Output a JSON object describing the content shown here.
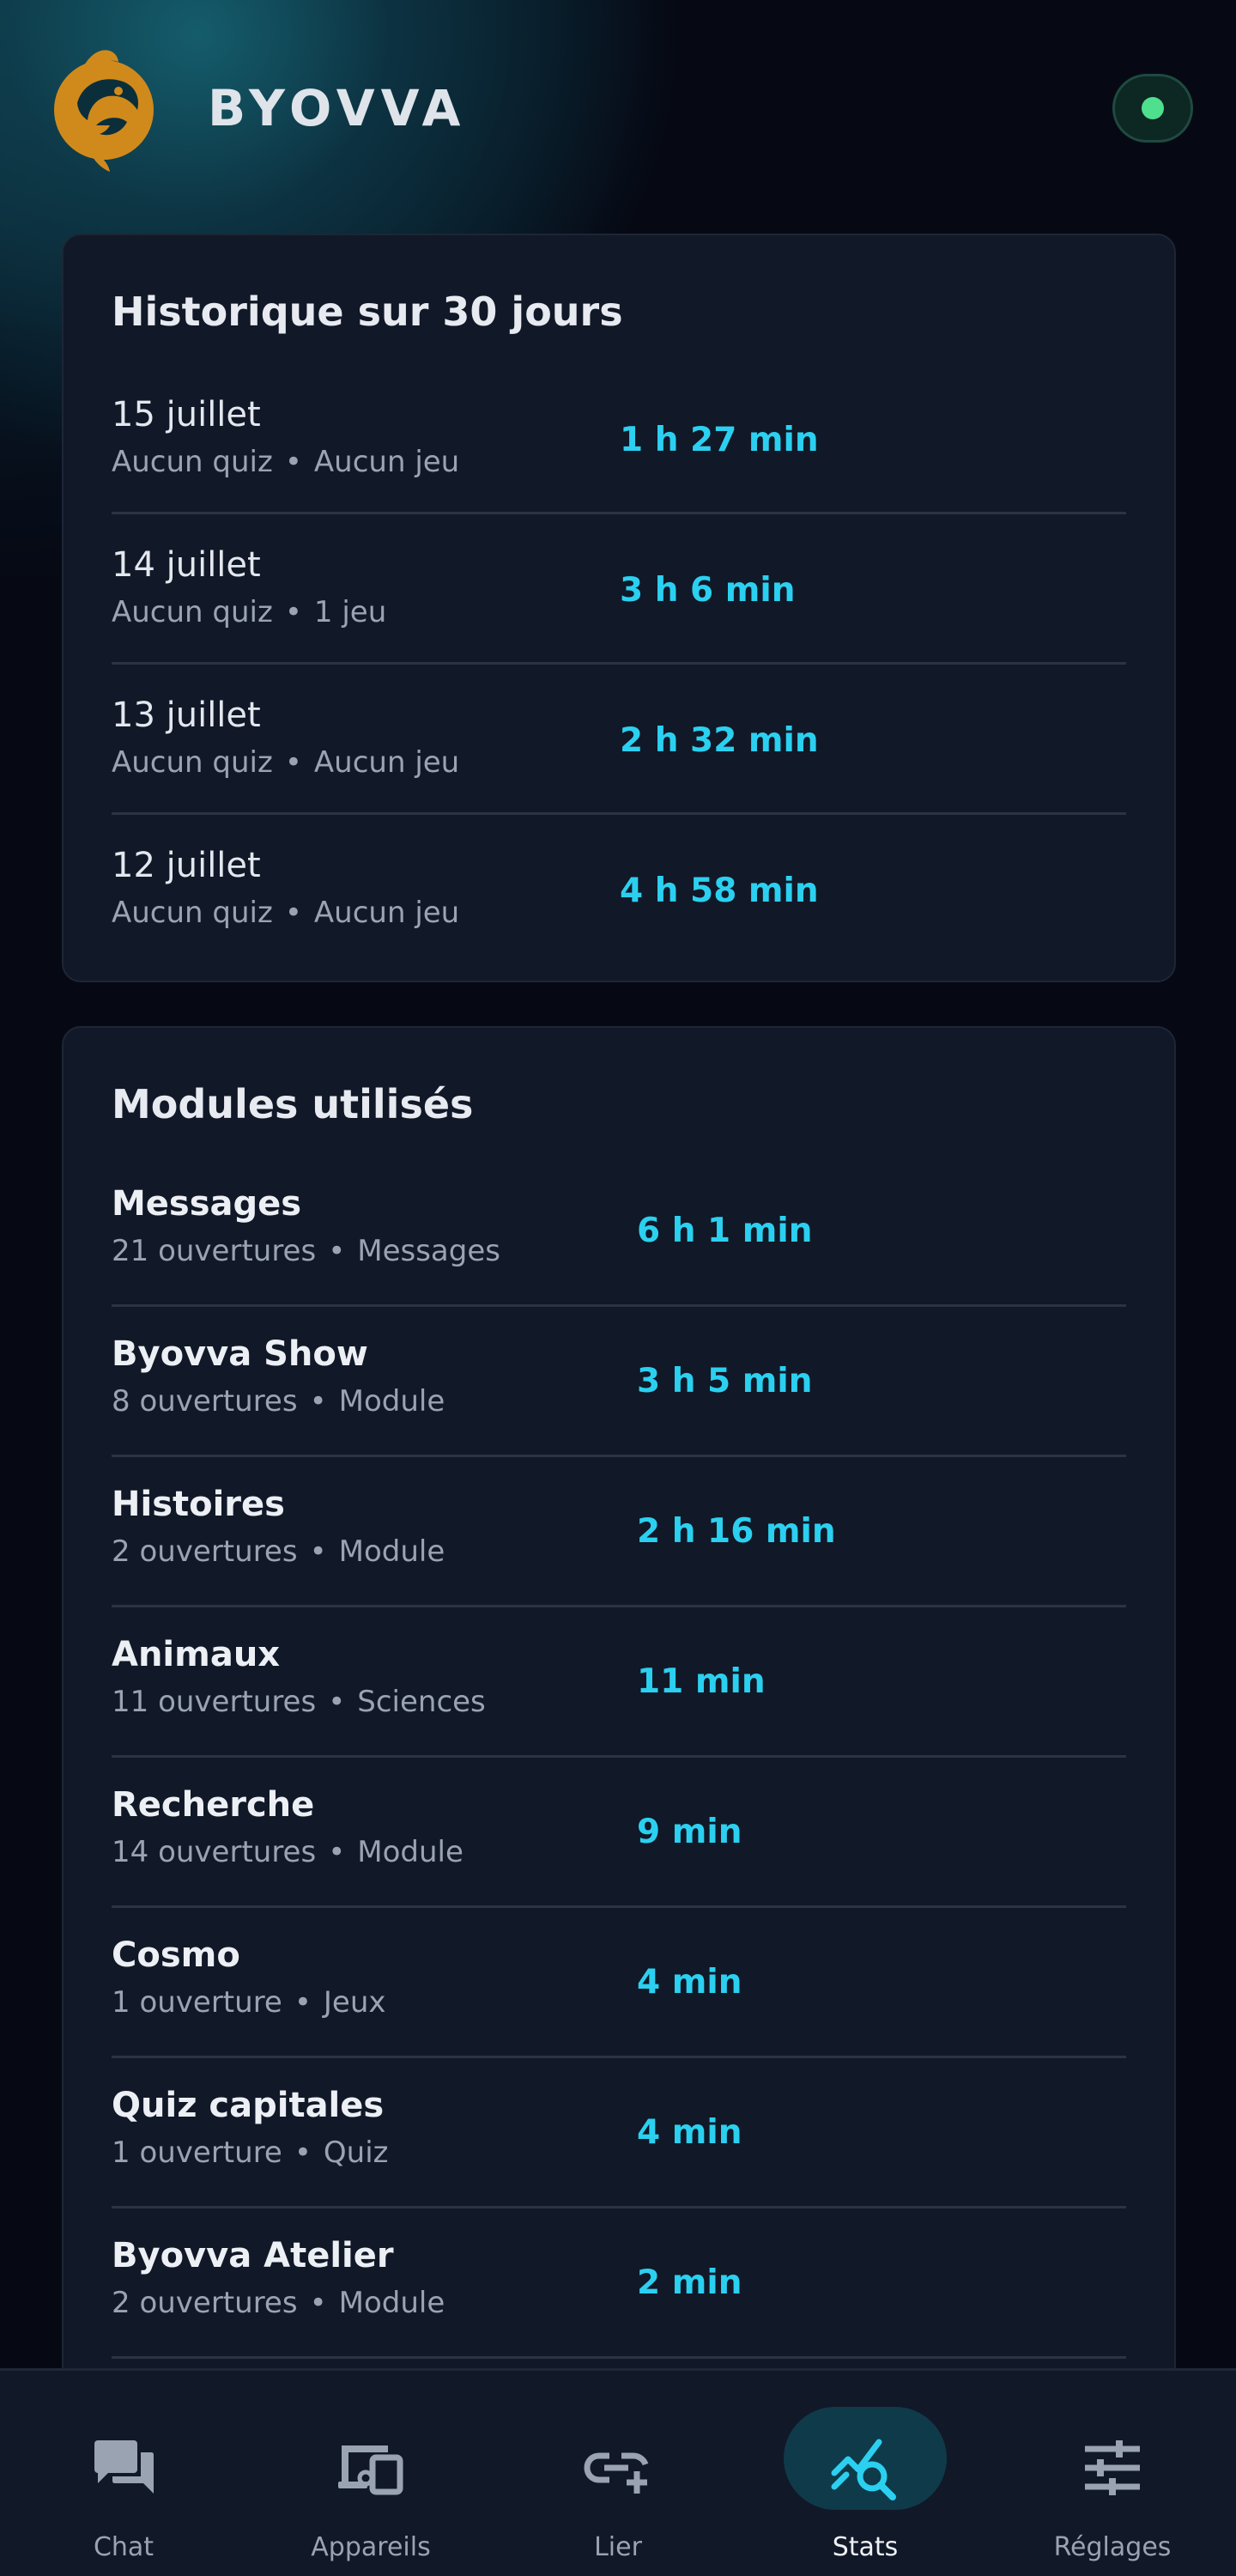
{
  "app": {
    "brand": "BYOVVA"
  },
  "history": {
    "title": "Historique sur 30 jours",
    "rows": [
      {
        "date": "15 juillet",
        "quiz": "Aucun quiz",
        "game": "Aucun jeu",
        "time": "1 h 27 min"
      },
      {
        "date": "14 juillet",
        "quiz": "Aucun quiz",
        "game": "1 jeu",
        "time": "3 h 6 min"
      },
      {
        "date": "13 juillet",
        "quiz": "Aucun quiz",
        "game": "Aucun jeu",
        "time": "2 h 32 min"
      },
      {
        "date": "12 juillet",
        "quiz": "Aucun quiz",
        "game": "Aucun jeu",
        "time": "4 h 58 min"
      }
    ]
  },
  "modules": {
    "title": "Modules utilisés",
    "rows": [
      {
        "name": "Messages",
        "opens": "21 ouvertures",
        "category": "Messages",
        "time": "6 h 1 min"
      },
      {
        "name": "Byovva Show",
        "opens": "8 ouvertures",
        "category": "Module",
        "time": "3 h 5 min"
      },
      {
        "name": "Histoires",
        "opens": "2 ouvertures",
        "category": "Module",
        "time": "2 h 16 min"
      },
      {
        "name": "Animaux",
        "opens": "11 ouvertures",
        "category": "Sciences",
        "time": "11 min"
      },
      {
        "name": "Recherche",
        "opens": "14 ouvertures",
        "category": "Module",
        "time": "9 min"
      },
      {
        "name": "Cosmo",
        "opens": "1 ouverture",
        "category": "Jeux",
        "time": "4 min"
      },
      {
        "name": "Quiz capitales",
        "opens": "1 ouverture",
        "category": "Quiz",
        "time": "4 min"
      },
      {
        "name": "Byovva Atelier",
        "opens": "2 ouvertures",
        "category": "Module",
        "time": "2 min"
      }
    ]
  },
  "separator": "•",
  "nav": {
    "items": [
      {
        "label": "Chat",
        "icon": "chat-icon",
        "active": false
      },
      {
        "label": "Appareils",
        "icon": "devices-icon",
        "active": false
      },
      {
        "label": "Lier",
        "icon": "link-add-icon",
        "active": false
      },
      {
        "label": "Stats",
        "icon": "stats-search-icon",
        "active": true
      },
      {
        "label": "Réglages",
        "icon": "sliders-icon",
        "active": false
      }
    ]
  },
  "colors": {
    "accent": "#2bd0f0",
    "logo": "#d08a1c",
    "status": "#4ee08e",
    "card": "#111827",
    "background": "#060914"
  }
}
